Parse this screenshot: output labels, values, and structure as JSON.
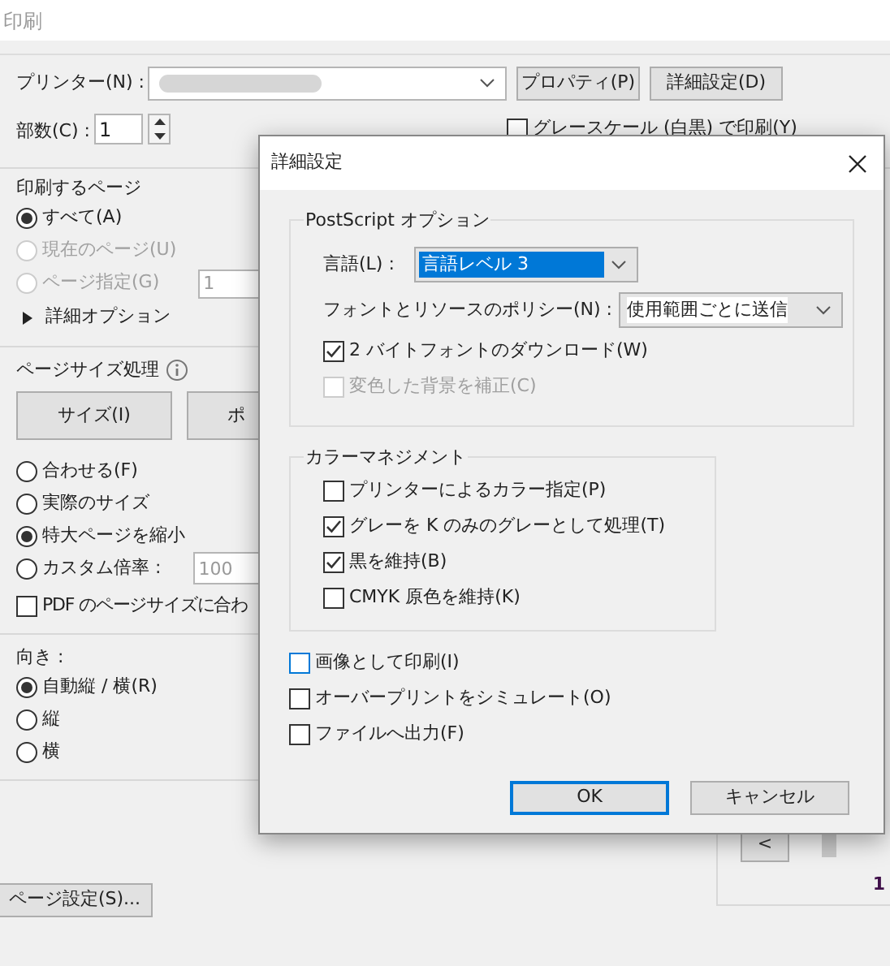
{
  "window": {
    "title": "印刷"
  },
  "printer": {
    "label": "プリンター(N) :",
    "properties_button": "プロパティ(P)",
    "advanced_button": "詳細設定(D)"
  },
  "copies": {
    "label": "部数(C) :",
    "value": "1"
  },
  "grayscale": {
    "label": "グレースケール (白黒) で印刷(Y)",
    "checked": false
  },
  "pages": {
    "heading": "印刷するページ",
    "options": [
      {
        "label": "すべて(A)",
        "selected": true,
        "disabled": false
      },
      {
        "label": "現在のページ(U)",
        "selected": false,
        "disabled": true
      },
      {
        "label": "ページ指定(G)",
        "selected": false,
        "disabled": true,
        "value": "1"
      }
    ],
    "more_options": "詳細オプション"
  },
  "page_sizing": {
    "heading": "ページサイズ処理",
    "buttons": [
      {
        "label": "サイズ(I)",
        "selected": false
      },
      {
        "label": "ポ",
        "selected": false
      }
    ],
    "options": [
      {
        "label": "合わせる(F)",
        "selected": false
      },
      {
        "label": "実際のサイズ",
        "selected": false
      },
      {
        "label": "特大ページを縮小",
        "selected": true
      },
      {
        "label": "カスタム倍率 :",
        "selected": false,
        "value": "100"
      }
    ],
    "pdf_size": {
      "label": "PDF のページサイズに合わ",
      "checked": false
    }
  },
  "orientation": {
    "heading": "向き :",
    "options": [
      {
        "label": "自動縦 / 横(R)",
        "selected": true
      },
      {
        "label": "縦",
        "selected": false
      },
      {
        "label": "横",
        "selected": false
      }
    ]
  },
  "page_setup_button": "ページ設定(S)...",
  "preview": {
    "prev_button": "<",
    "page_number": "1"
  },
  "dialog": {
    "title": "詳細設定",
    "postscript": {
      "heading": "PostScript オプション",
      "language": {
        "label": "言語(L) :",
        "value": "言語レベル 3"
      },
      "font_policy": {
        "label": "フォントとリソースのポリシー(N) :",
        "value": "使用範囲ごとに送信"
      },
      "checkboxes": [
        {
          "label": "2 バイトフォントのダウンロード(W)",
          "checked": true,
          "disabled": false
        },
        {
          "label": "変色した背景を補正(C)",
          "checked": false,
          "disabled": true
        }
      ]
    },
    "color": {
      "heading": "カラーマネジメント",
      "checkboxes": [
        {
          "label": "プリンターによるカラー指定(P)",
          "checked": false
        },
        {
          "label": "グレーを K のみのグレーとして処理(T)",
          "checked": true
        },
        {
          "label": "黒を維持(B)",
          "checked": true
        },
        {
          "label": "CMYK 原色を維持(K)",
          "checked": false
        }
      ]
    },
    "checkboxes": [
      {
        "label": "画像として印刷(I)",
        "checked": false,
        "focused": true
      },
      {
        "label": "オーバープリントをシミュレート(O)",
        "checked": false,
        "focused": false
      },
      {
        "label": "ファイルへ出力(F)",
        "checked": false,
        "focused": false
      }
    ],
    "buttons": [
      {
        "label": "OK",
        "default": true
      },
      {
        "label": "キャンセル",
        "default": false
      }
    ]
  }
}
